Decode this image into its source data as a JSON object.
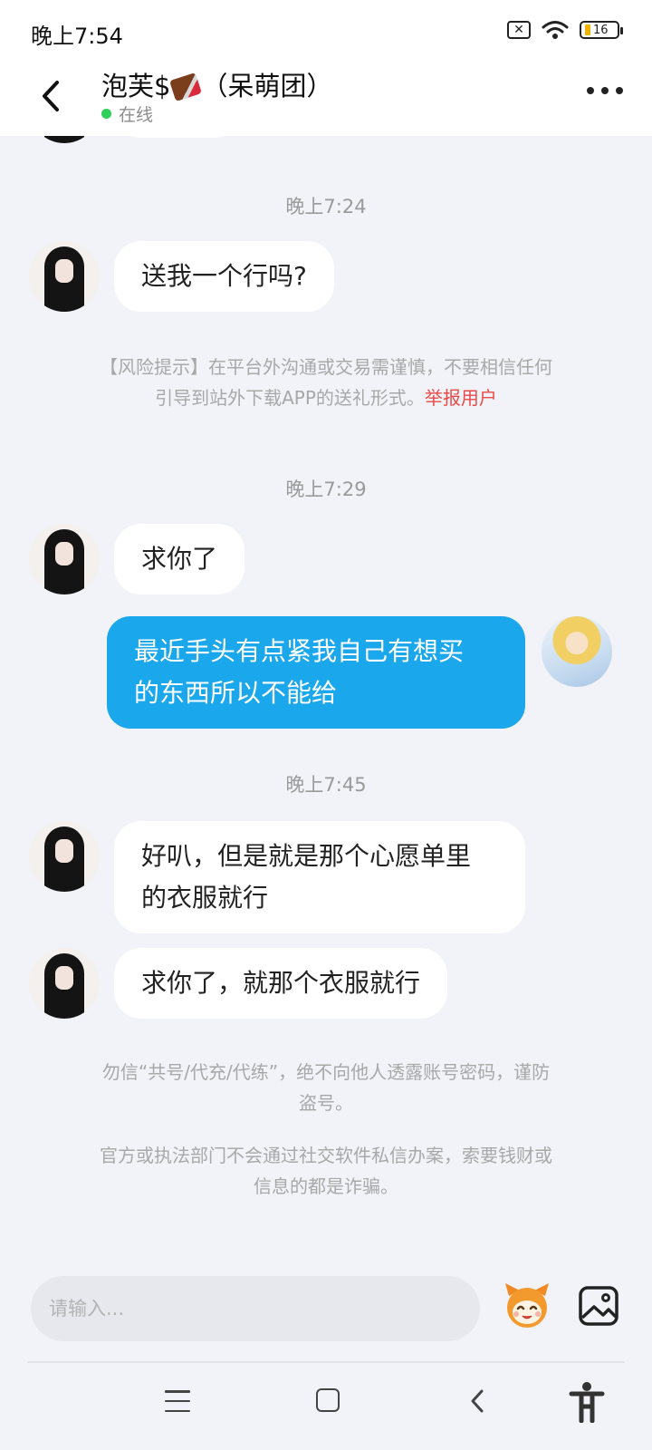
{
  "status_bar": {
    "time": "晚上7:54",
    "battery_level": "16",
    "icons": [
      "sim-off-icon",
      "wifi-icon",
      "battery-icon"
    ]
  },
  "header": {
    "title_prefix": "泡芙$",
    "title_emoji": "chocolate-bar",
    "title_suffix": "（呆萌团）",
    "status": "在线",
    "back_icon": "back-chevron-icon",
    "more_icon": "more-dots-icon"
  },
  "conversation": {
    "timestamps": [
      "晚上7:24",
      "晚上7:29",
      "晚上7:45"
    ],
    "messages": [
      {
        "from": "other",
        "text": "送我一个行吗?"
      },
      {
        "from": "other",
        "text": "求你了"
      },
      {
        "from": "me",
        "line1": "最近手头有点紧我自己有想买",
        "line2": "的东西所以不能给"
      },
      {
        "from": "other",
        "line1": "好叭，但是就是那个心愿单里",
        "line2": "的衣服就行"
      },
      {
        "from": "other",
        "text": "求你了，就那个衣服就行"
      }
    ],
    "risk_notice": {
      "line1": "【风险提示】在平台外沟通或交易需谨慎，不要相信任何",
      "line2": "引导到站外下载APP的送礼形式。",
      "link": "举报用户"
    },
    "footer_notices": [
      {
        "line1": "勿信“共号/代充/代练”，绝不向他人透露账号密码，谨防",
        "line2": "盗号。"
      },
      {
        "line1": "官方或执法部门不会通过社交软件私信办案，索要钱财或",
        "line2": "信息的都是诈骗。"
      }
    ]
  },
  "input_bar": {
    "placeholder": "请输入...",
    "value": "",
    "emoji_icon": "emoji-mascot-icon",
    "image_icon": "image-picker-icon"
  },
  "nav_bar": {
    "icons": [
      "menu-icon",
      "home-icon",
      "back-icon",
      "accessibility-icon"
    ]
  },
  "colors": {
    "accent_bubble": "#1aa7ec",
    "online": "#2ecf5a",
    "report_link": "#e84a4a",
    "background": "#f1f3f8"
  }
}
